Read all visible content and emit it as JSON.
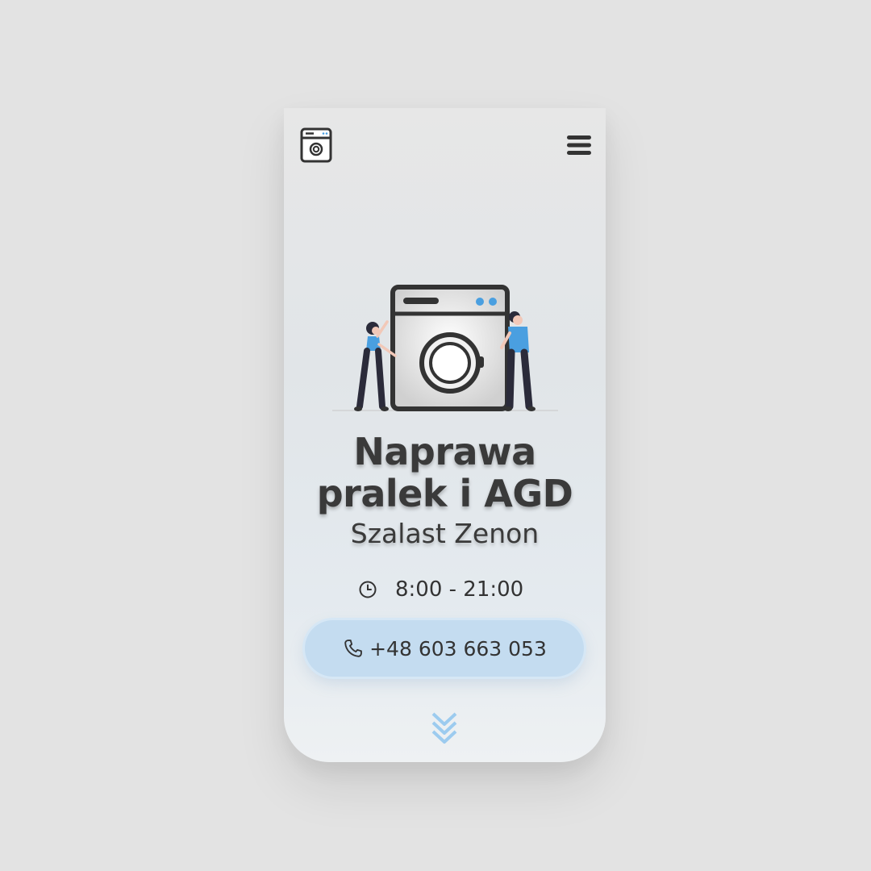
{
  "header": {
    "logo_icon": "washing-machine-icon",
    "menu_icon": "hamburger-icon"
  },
  "hero": {
    "illustration": "people-fixing-washing-machine",
    "accent_color": "#4a9fe0"
  },
  "title": "Naprawa pralek i AGD",
  "subtitle": "Szalast Zenon",
  "hours": {
    "icon": "clock-icon",
    "text": "8:00 - 21:00"
  },
  "phone_button": {
    "icon": "phone-icon",
    "label": "+48 603 663 053",
    "color": "#c4dcf0"
  },
  "scroll": {
    "icon": "chevrons-down-icon",
    "color": "#9ccbef"
  }
}
